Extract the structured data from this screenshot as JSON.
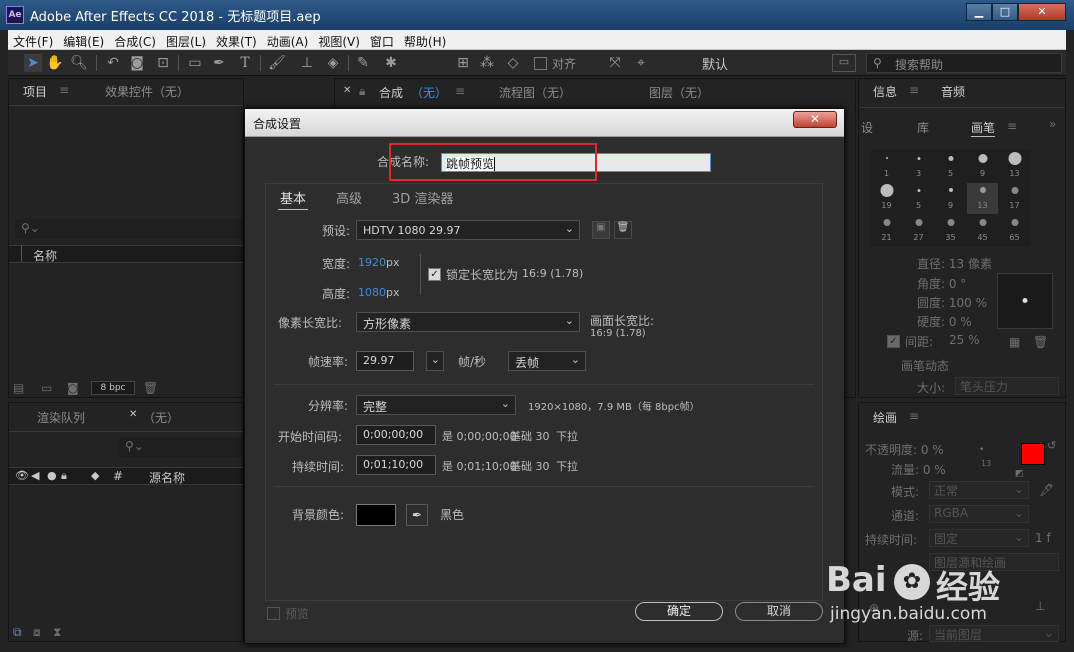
{
  "window": {
    "title": "Adobe After Effects CC 2018 - 无标题项目.aep",
    "logo": "Ae",
    "min": "▁",
    "max": "□",
    "close": "✕"
  },
  "menu": [
    "文件(F)",
    "编辑(E)",
    "合成(C)",
    "图层(L)",
    "效果(T)",
    "动画(A)",
    "视图(V)",
    "窗口",
    "帮助(H)"
  ],
  "toolbar": {
    "align_label": "对齐",
    "workspace": "默认",
    "search_placeholder": "搜索帮助"
  },
  "project_panel": {
    "tab_project": "项目",
    "tab_effects": "效果控件（无）",
    "col_name": "名称",
    "bpc": "8 bpc"
  },
  "comp_panel": {
    "tab_comp": "合成",
    "tab_comp_state": "（无）",
    "tab_flow": "流程图（无）",
    "tab_layer": "图层（无）"
  },
  "render_panel": {
    "tab_queue": "渲染队列",
    "tab_none": "（无）",
    "col_num": "#",
    "col_source": "源名称"
  },
  "right_panel": {
    "tab_info": "信息",
    "tab_audio": "音频",
    "tab_settings": "设",
    "tab_library": "库",
    "tab_brush": "画笔",
    "brush_sizes": [
      "1",
      "3",
      "5",
      "9",
      "13",
      "19",
      "5",
      "9",
      "13",
      "17",
      "21",
      "27",
      "35",
      "45",
      "65"
    ],
    "diameter": "直径: 13 像素",
    "angle": "角度: 0 °",
    "roundness": "圆度: 100 %",
    "hardness": "硬度: 0 %",
    "spacing": "间距:",
    "spacing_val": "25 %",
    "dynamics": "画笔动态",
    "size": "大小:",
    "size_val": "笔头压力",
    "paint_tab": "绘画",
    "opacity": "不透明度: 0 %",
    "flow": "流量: 0 %",
    "brush_num": "13",
    "mode_lbl": "模式:",
    "mode_val": "正常",
    "channel_lbl": "通道:",
    "channel_val": "RGBA",
    "duration_lbl": "持续时间:",
    "duration_val": "固定",
    "duration_suffix": "1 f",
    "source_lbl": "源:",
    "source_val": "当前图层",
    "layer_src": "图层源和绘画",
    "fg_color": "#ff0000",
    "bg_color": "#ffffff"
  },
  "dialog": {
    "title": "合成设置",
    "close": "✕",
    "name_label": "合成名称:",
    "name_value": "跳帧预览",
    "tabs": [
      "基本",
      "高级",
      "3D 渲染器"
    ],
    "preset_label": "预设:",
    "preset_value": "HDTV 1080 29.97",
    "width_label": "宽度:",
    "width_value": "1920",
    "height_label": "高度:",
    "height_value": "1080",
    "px": "px",
    "lock_label": "锁定长宽比为",
    "lock_value": "16:9 (1.78)",
    "pixel_aspect_label": "像素长宽比:",
    "pixel_aspect_value": "方形像素",
    "frame_aspect_label": "画面长宽比:",
    "frame_aspect_value": "16:9 (1.78)",
    "framerate_label": "帧速率:",
    "framerate_value": "29.97",
    "fps_unit": "帧/秒",
    "drop_frame": "丢帧",
    "resolution_label": "分辨率:",
    "resolution_value": "完整",
    "resolution_info": "1920×1080，7.9 MB（每 8bpc帧）",
    "start_label": "开始时间码:",
    "start_value": "0;00;00;00",
    "start_info": "是 0;00;00;00",
    "start_base": "基础 30",
    "start_pull": "下拉",
    "duration_label": "持续时间:",
    "duration_value": "0;01;10;00",
    "duration_info": "是 0;01;10;00",
    "duration_base": "基础 30",
    "duration_pull": "下拉",
    "bg_label": "背景颜色:",
    "bg_name": "黑色",
    "bg_color": "#000000",
    "preview_label": "预览",
    "ok": "确定",
    "cancel": "取消"
  },
  "watermark": {
    "brand": "Bai",
    "brand2": "经验",
    "url": "jingyan.baidu.com"
  }
}
